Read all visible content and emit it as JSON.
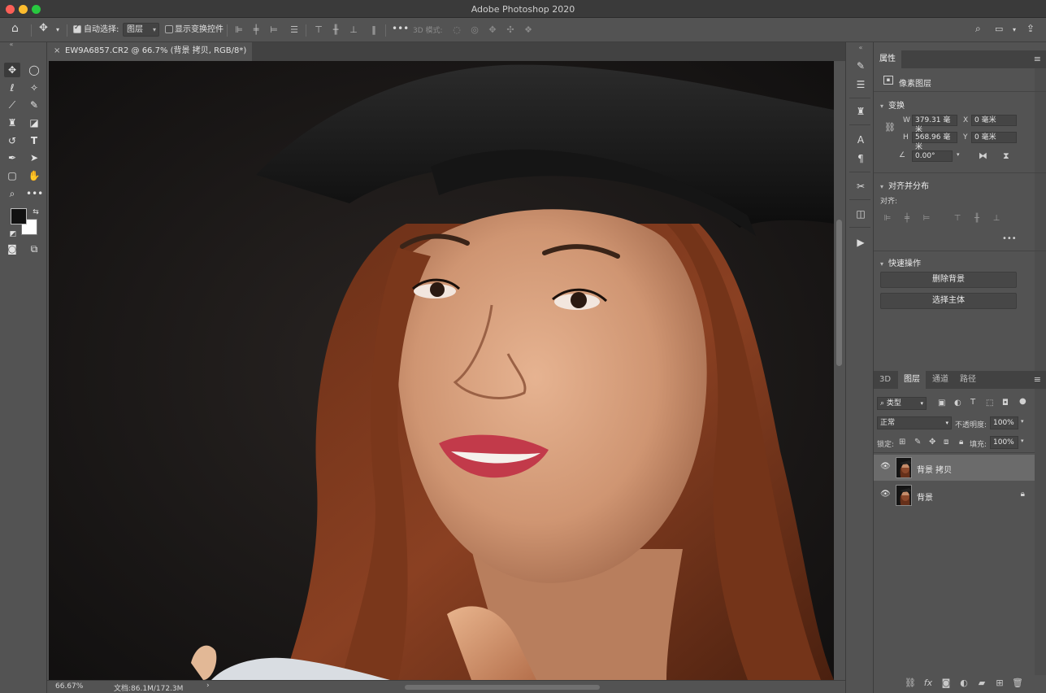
{
  "window": {
    "title": "Adobe Photoshop 2020"
  },
  "options_bar": {
    "auto_select_label": "自动选择:",
    "auto_select_checked": true,
    "auto_select_target": "图层",
    "show_transform_label": "显示变换控件",
    "show_transform_checked": false,
    "mode_3d_label": "3D 模式:"
  },
  "document": {
    "tab_title": "EW9A6857.CR2 @ 66.7% (背景 拷贝, RGB/8*) *",
    "zoom": "66.67%",
    "doc_size": "文档:86.1M/172.3M"
  },
  "properties": {
    "tab": "属性",
    "layer_type": "像素图层",
    "transform_title": "变换",
    "w_label": "W",
    "w_value": "379.31 毫米",
    "h_label": "H",
    "h_value": "568.96 毫米",
    "x_label": "X",
    "x_value": "0 毫米",
    "y_label": "Y",
    "y_value": "0 毫米",
    "angle_value": "0.00°",
    "align_title": "对齐并分布",
    "align_label": "对齐:",
    "quick_actions_title": "快速操作",
    "remove_bg_button": "删除背景",
    "select_subject_button": "选择主体"
  },
  "layers_panel": {
    "tabs": [
      "3D",
      "图层",
      "通道",
      "路径"
    ],
    "active_tab": "图层",
    "filter_kind": "类型",
    "blend_mode": "正常",
    "opacity_label": "不透明度:",
    "opacity_value": "100%",
    "lock_label": "锁定:",
    "fill_label": "填充:",
    "fill_value": "100%",
    "layers": [
      {
        "name": "背景 拷贝",
        "selected": true,
        "locked": false,
        "visible": true
      },
      {
        "name": "背景",
        "selected": false,
        "locked": true,
        "visible": true
      }
    ]
  },
  "colors": {
    "foreground": "#111111",
    "background": "#ffffff",
    "ui_panel": "#535353",
    "ui_dark": "#424242"
  }
}
